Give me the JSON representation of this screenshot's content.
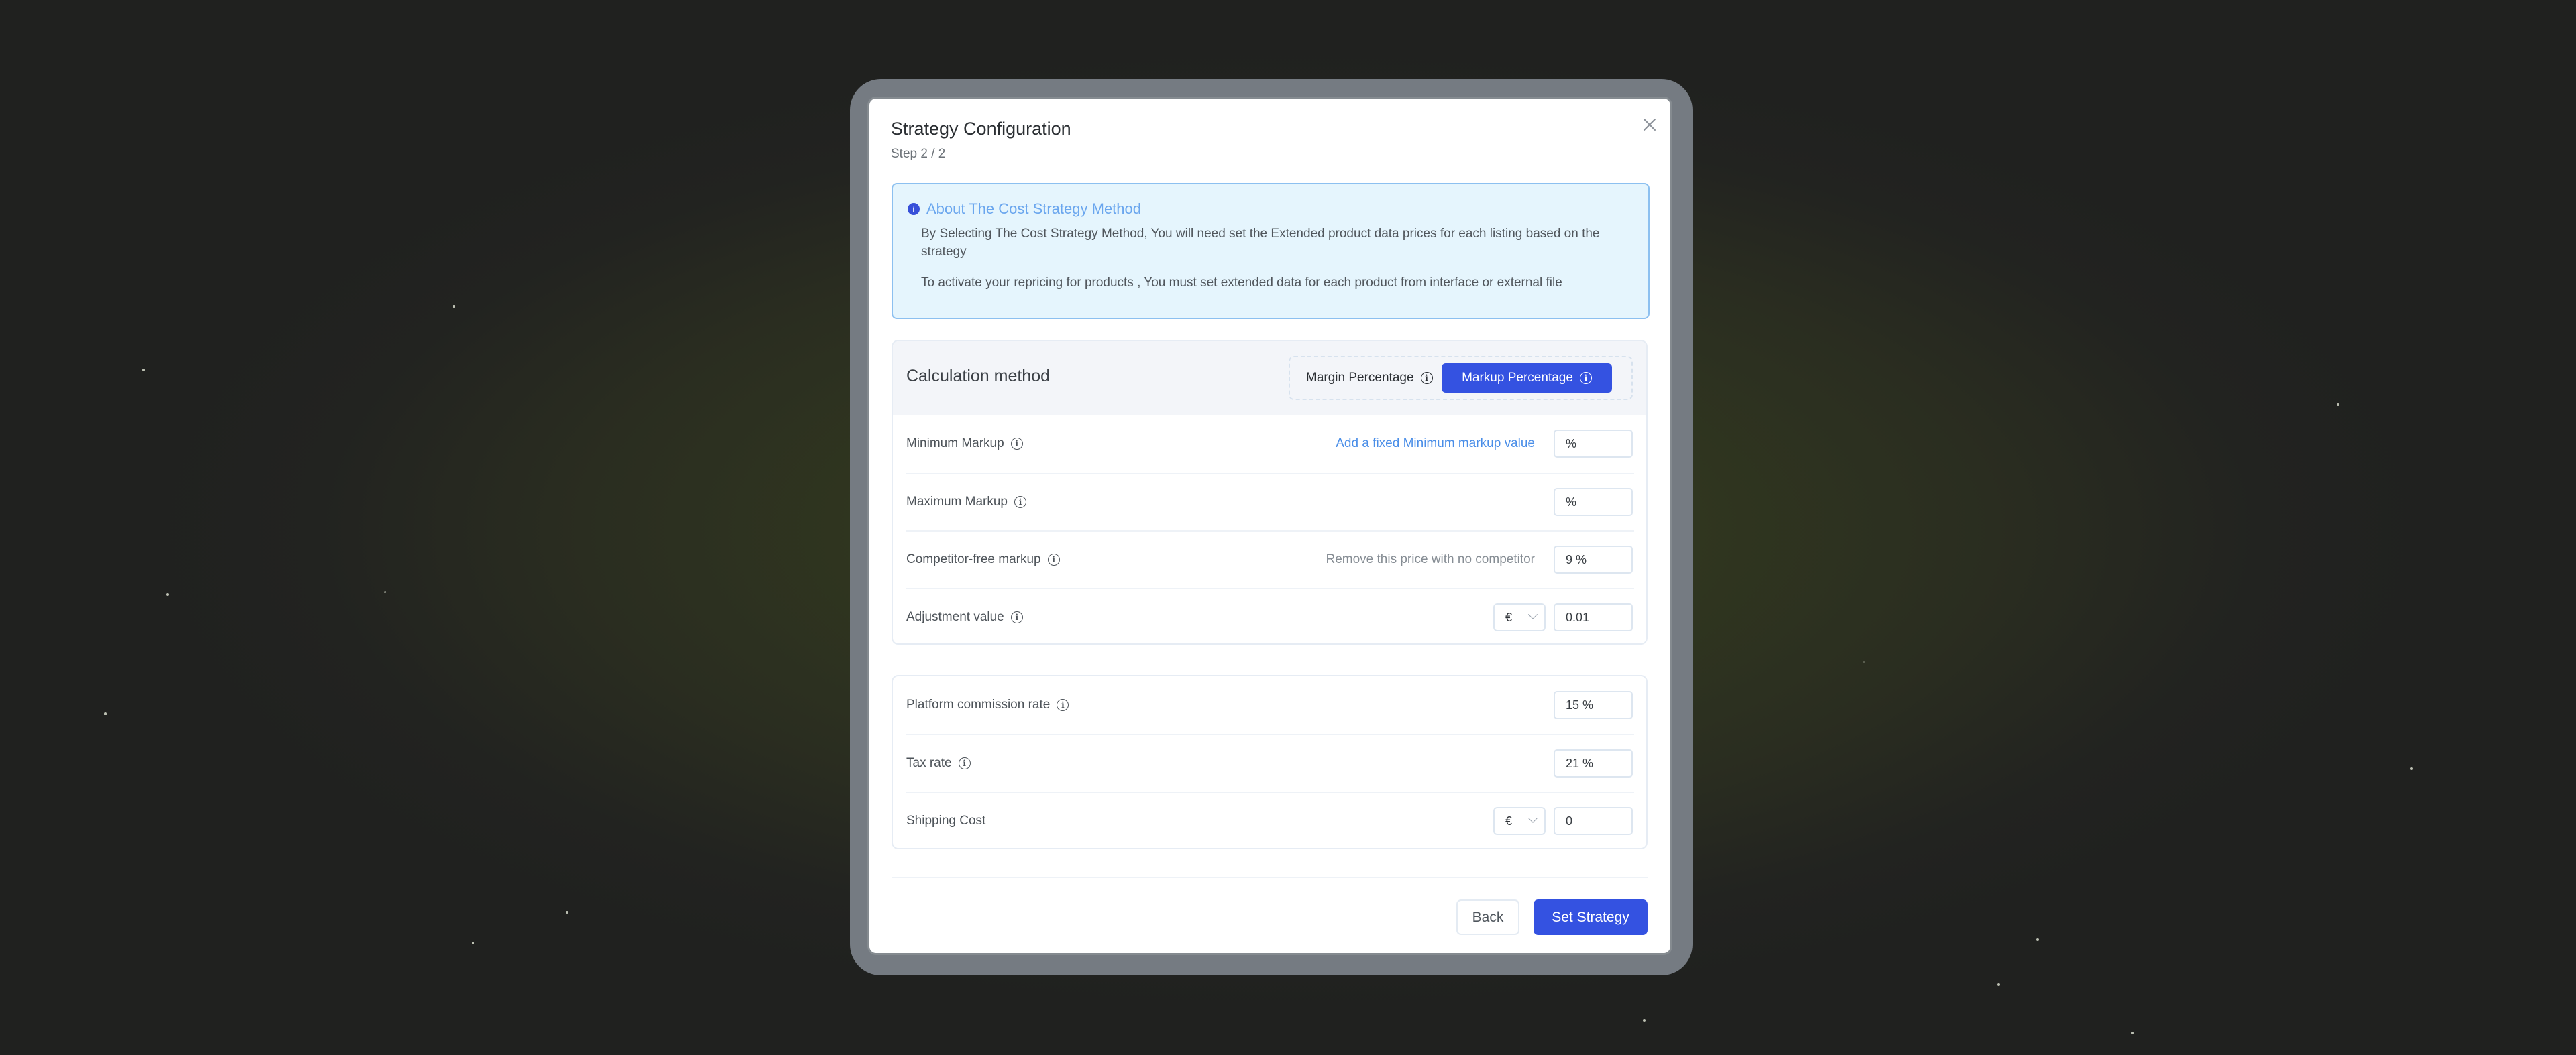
{
  "modal": {
    "title": "Strategy Configuration",
    "step": "Step 2 / 2",
    "close_icon": "close-icon"
  },
  "info": {
    "icon": "info-filled-icon",
    "title": "About The Cost Strategy Method",
    "paragraphs": [
      "By Selecting The Cost Strategy Method, You will need set the Extended product data prices for each listing based on the strategy",
      "To activate your repricing for products , You must set extended data for each product from interface or external file"
    ]
  },
  "calculation": {
    "title": "Calculation method",
    "options": [
      {
        "label": "Margin Percentage",
        "selected": false
      },
      {
        "label": "Markup Percentage",
        "selected": true
      }
    ],
    "rows": [
      {
        "label": "Minimum Markup",
        "has_info": true,
        "link": "Add a fixed Minimum markup value",
        "value": "%"
      },
      {
        "label": "Maximum Markup",
        "has_info": true,
        "value": "%"
      },
      {
        "label": "Competitor-free markup",
        "has_info": true,
        "hint": "Remove this price with no competitor",
        "value": "9 %"
      },
      {
        "label": "Adjustment value",
        "has_info": true,
        "currency": "€",
        "value": "0.01"
      }
    ]
  },
  "costs": {
    "rows": [
      {
        "label": "Platform commission rate",
        "has_info": true,
        "value": "15 %"
      },
      {
        "label": "Tax rate",
        "has_info": true,
        "value": "21 %"
      },
      {
        "label": "Shipping Cost",
        "has_info": false,
        "currency": "€",
        "value": "0"
      }
    ]
  },
  "footer": {
    "back_label": "Back",
    "submit_label": "Set Strategy"
  },
  "colors": {
    "primary": "#3452e1",
    "info_bg": "#e5f5fd",
    "info_title": "#6aa6ee",
    "link": "#4a8ee8",
    "frame": "#757b82"
  },
  "icons": {
    "info_outline": "i"
  }
}
